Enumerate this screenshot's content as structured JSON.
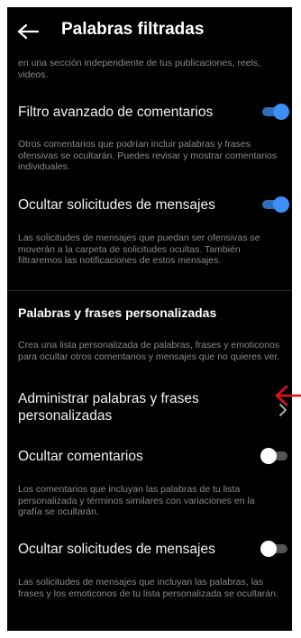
{
  "header": {
    "back_icon": "arrow-left-icon",
    "title": "Palabras filtradas"
  },
  "top_description": "en una sección independiente de tus publicaciones, reels, videos.",
  "settings": [
    {
      "label": "Filtro avanzado de comentarios",
      "enabled": true,
      "description": "Otros comentarios que podrían incluir palabras y frases ofensivas se ocultarán. Puedes revisar y mostrar comentarios individuales."
    },
    {
      "label": "Ocultar solicitudes de mensajes",
      "enabled": true,
      "description": "Las solicitudes de mensajes que puedan ser ofensivas se moverán a la carpeta de solicitudes ocultas. También filtraremos las notificaciones de estos mensajes."
    }
  ],
  "custom_section": {
    "title": "Palabras y frases personalizadas",
    "description": "Crea una lista personalizada de palabras, frases y emoticonos para ocultar otros comentarios y mensajes que no quieres ver.",
    "manage_label": "Administrar palabras y frases personalizadas",
    "manage_icon": "chevron-right-icon",
    "settings": [
      {
        "label": "Ocultar comentarios",
        "enabled": false,
        "description": "Los comentarios que incluyan las palabras de tu lista personalizada y términos similares con variaciones en la grafía se ocultarán."
      },
      {
        "label": "Ocultar solicitudes de mensajes",
        "enabled": false,
        "description": "Las solicitudes de mensajes que incluyan las palabras, las frases y los emoticonos de tu lista personalizada se ocultarán."
      }
    ]
  },
  "annotation": {
    "icon": "red-arrow-icon",
    "color": "#e0101c"
  },
  "colors": {
    "background": "#000000",
    "toggle_on": "#3d8ff5",
    "toggle_off_track": "#545454",
    "secondary_text": "#8a8a8a"
  }
}
